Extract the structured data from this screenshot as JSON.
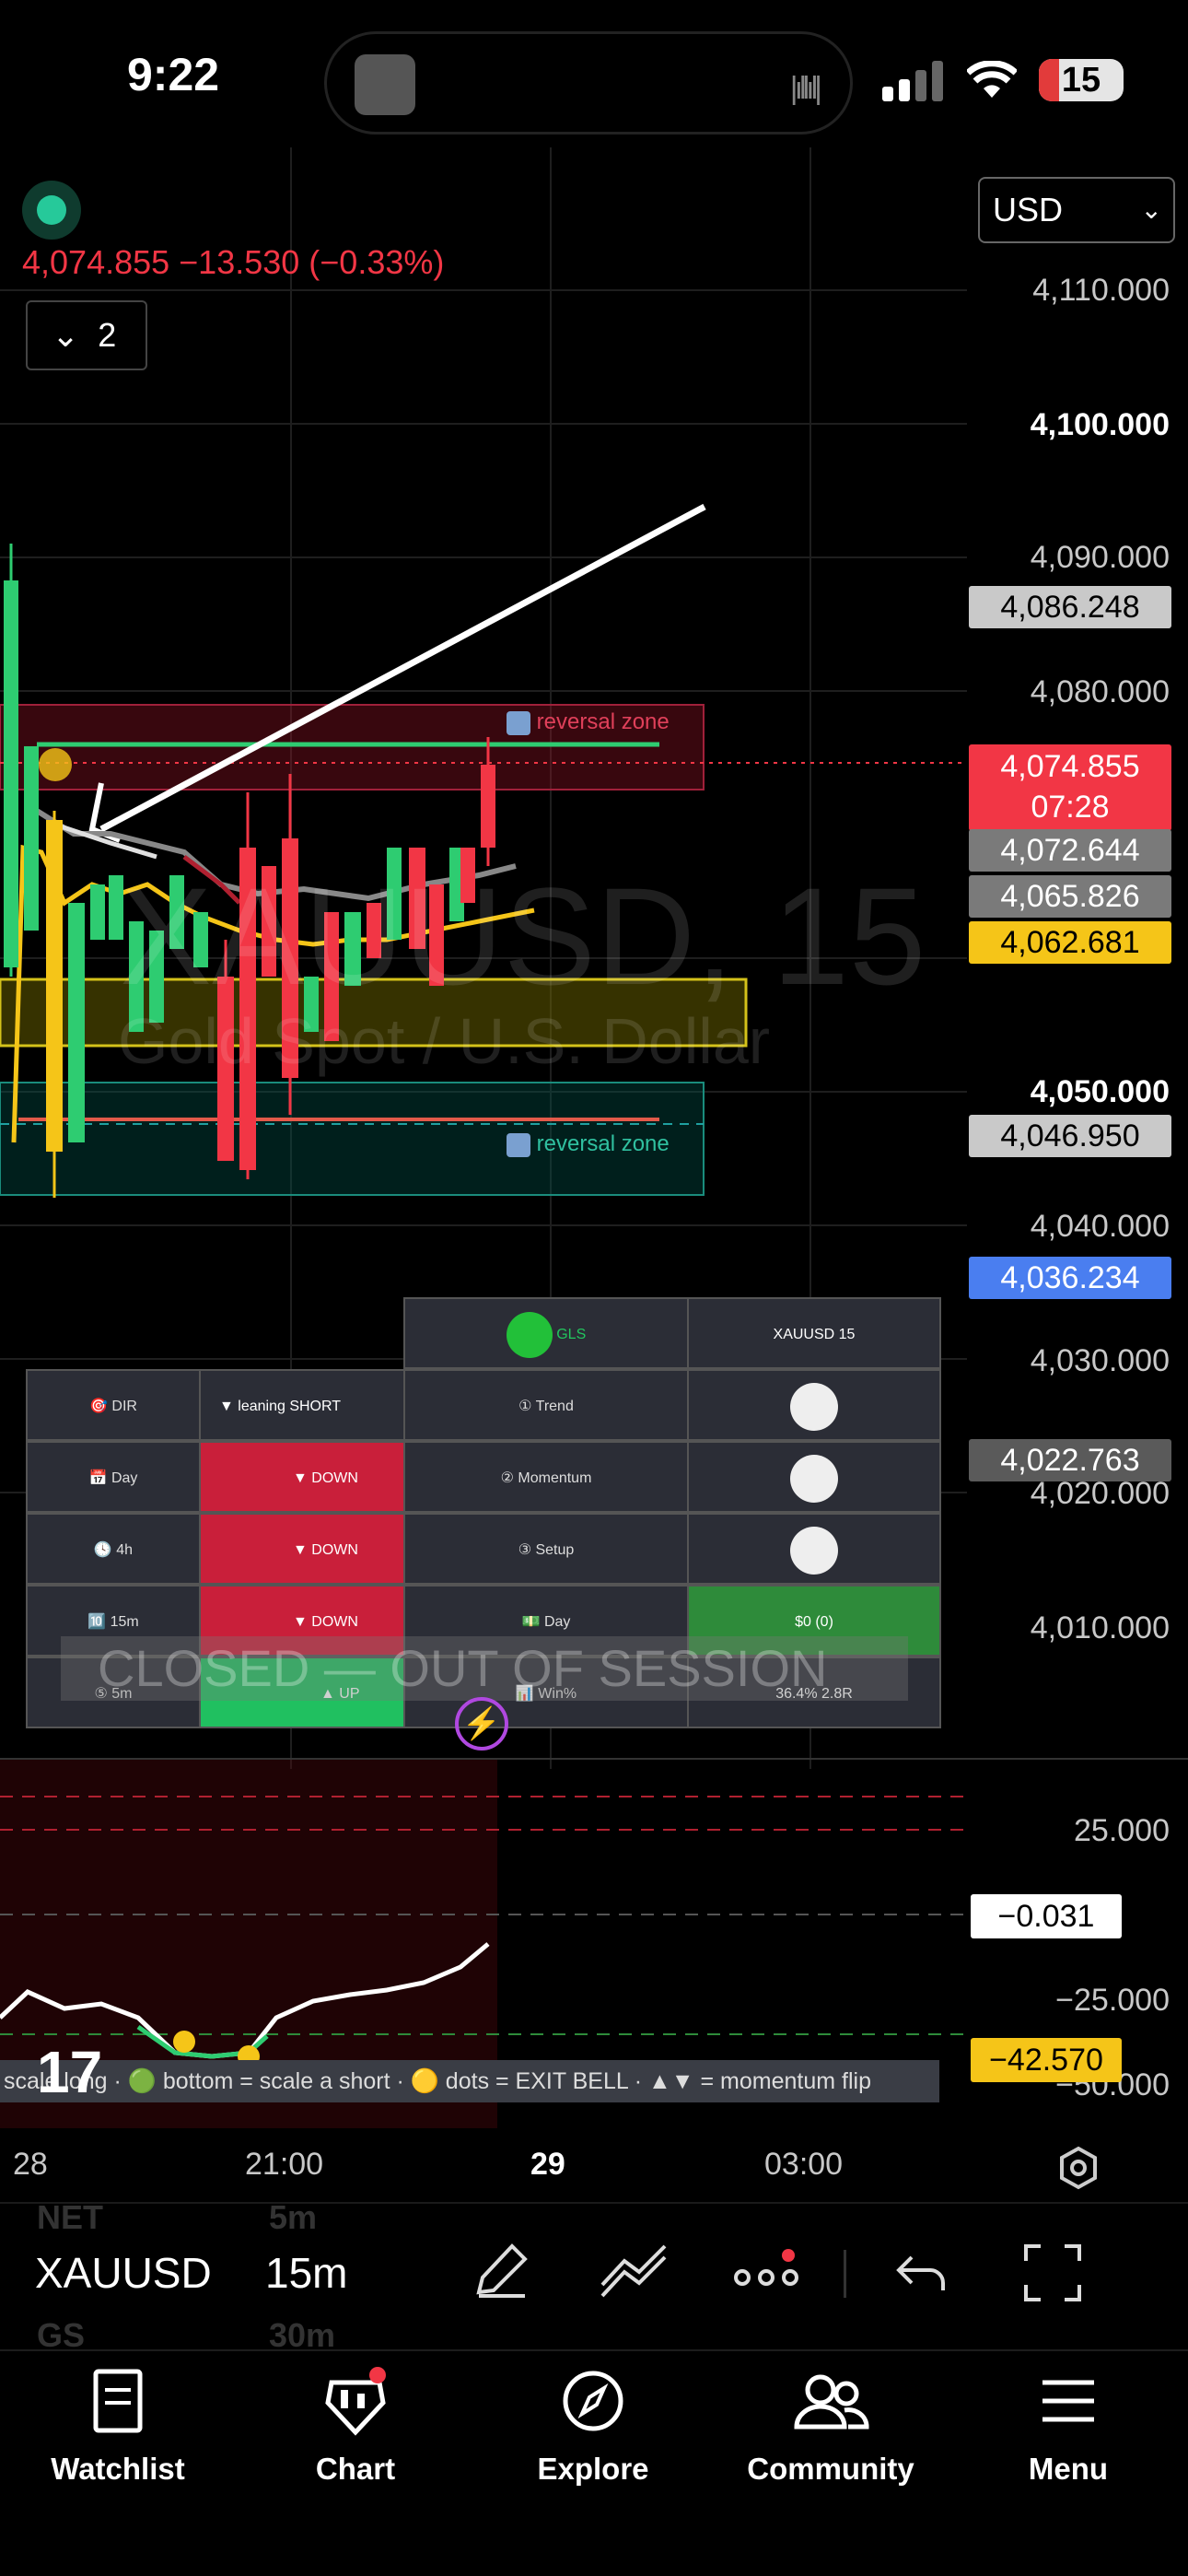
{
  "status_bar": {
    "time": "9:22",
    "battery": "15"
  },
  "chart": {
    "currency": "USD",
    "quote": "4,074.855  −13.530 (−0.33%)",
    "indicator_count": "2",
    "watermark_symbol": "XAUUSD, 15",
    "watermark_name": "Gold Spot / U.S. Dollar",
    "zone_top": "reversal zone",
    "zone_bottom": "reversal zone",
    "price_ticks": [
      "4,110.000",
      "4,100.000",
      "4,090.000",
      "4,080.000",
      "4,050.000",
      "4,040.000",
      "4,030.000",
      "4,020.000",
      "4,010.000"
    ],
    "price_labels": {
      "l1": "4,086.248",
      "l2": "4,074.855",
      "l2_time": "07:28",
      "l3": "4,072.644",
      "l4": "4,065.826",
      "l5": "4,062.681",
      "l6": "4,046.950",
      "l7": "4,036.234",
      "l8": "4,022.763"
    },
    "colors": {
      "up": "#26d07c",
      "down": "#f23645",
      "accent": "#2962ff",
      "yellow": "#f5c518"
    }
  },
  "gls_table": {
    "header_left": "GLS",
    "header_right": "XAUUSD 15",
    "rows": [
      {
        "label": "① Trend",
        "value": ""
      },
      {
        "label": "② Momentum",
        "value": ""
      },
      {
        "label": "③ Setup",
        "value": ""
      },
      {
        "label": "Day",
        "value": "$0 (0)"
      },
      {
        "label": "Win%",
        "value": "36.4%  2.8R"
      }
    ]
  },
  "dir_table": {
    "rows": [
      {
        "icon": "🎯",
        "label": "DIR",
        "value": "▼ leaning SHORT"
      },
      {
        "icon": "📅",
        "label": "Day",
        "value": "▼ DOWN"
      },
      {
        "icon": "🕓",
        "label": "4h",
        "value": "▼ DOWN"
      },
      {
        "icon": "🔟",
        "label": "15m",
        "value": "▼ DOWN"
      },
      {
        "icon": "⑤",
        "label": "5m",
        "value": "▲ UP"
      }
    ],
    "overlay": "CLOSED — OUT OF SESSION"
  },
  "oscillator": {
    "ticks": [
      "25.000",
      "−25.000",
      "−50.000"
    ],
    "current": "−0.031",
    "low": "−42.570",
    "legend": "scale long · 🟢 bottom = scale a short · 🟡 dots = EXIT BELL · ▲▼ = momentum flip"
  },
  "time_axis": [
    "28",
    "21:00",
    "29",
    "03:00"
  ],
  "toolbar": {
    "symbol": "XAUUSD",
    "timeframe": "15m",
    "ghost1": "NET",
    "ghost2": "5m",
    "ghost3": "GS",
    "ghost4": "30m"
  },
  "nav": {
    "items": [
      {
        "label": "Watchlist"
      },
      {
        "label": "Chart"
      },
      {
        "label": "Explore"
      },
      {
        "label": "Community"
      },
      {
        "label": "Menu"
      }
    ]
  }
}
